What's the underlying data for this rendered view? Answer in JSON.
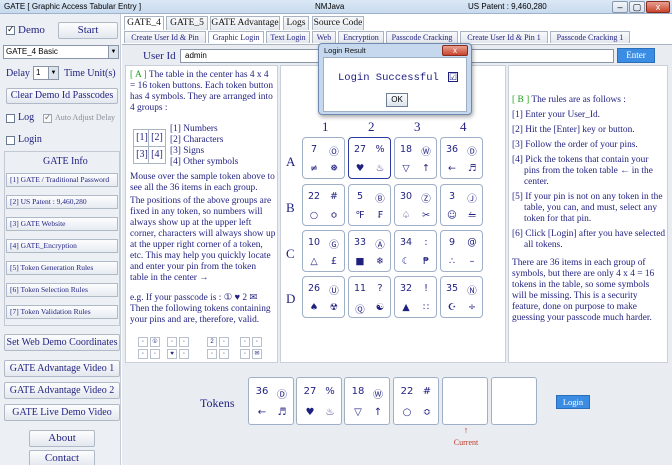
{
  "window": {
    "title": "GATE [ Graphic Access Tabular Entry ]",
    "center_title": "NMJava",
    "patent": "US Patent : 9,460,280",
    "min": "–",
    "max": "▢",
    "close": "x"
  },
  "sidebar": {
    "demo_label": "Demo",
    "start_label": "Start",
    "dropdown_value": "GATE_4 Basic",
    "delay_label": "Delay",
    "delay_value": "1",
    "time_unit_label": "Time Unit(s)",
    "clear_label": "Clear Demo Id Passcodes",
    "log_label": "Log",
    "auto_adjust_label": "Auto Adjust Delay",
    "login_label": "Login",
    "gate_info_label": "GATE Info",
    "info_items": [
      "[1] GATE / Traditional Password",
      "[2] US Patent : 9,460,280",
      "[3] GATE Website",
      "[4] GATE_Encryption",
      "[5] Token Generation Rules",
      "[6] Token Selection Rules",
      "[7] Token Validation Rules"
    ],
    "set_web_label": "Set Web Demo Coordinates",
    "video1_label": "GATE Advantage Video 1",
    "video2_label": "GATE Advantage Video 2",
    "live_label": "GATE Live Demo Video",
    "about_label": "About",
    "contact_label": "Contact"
  },
  "tabs": [
    "GATE_4",
    "GATE_5",
    "GATE Advantage",
    "Logs",
    "Source Code"
  ],
  "subtabs": [
    "Create User Id & Pin",
    "Graphic Login",
    "Text Login",
    "Web",
    "Encryption",
    "Passcode Cracking",
    "Create User Id & Pin 1",
    "Passcode Cracking 1"
  ],
  "user_id": {
    "label": "User Id",
    "value": "admin",
    "enter_label": "Enter"
  },
  "left_text": {
    "a_label": "[ A ]",
    "p1": "The table in the center has 4 x 4 = 16 token buttons. Each token button has 4 symbols. They are arranged into 4 groups :",
    "groups": [
      "[1] Numbers",
      "[2] Characters",
      "[3] Signs",
      "[4] Other symbols"
    ],
    "sample_keys": [
      "[1]",
      "[2]",
      "[3]",
      "[4]"
    ],
    "p2": "Mouse over the sample token above to see all the 36 items in each group.",
    "p3": "The positions of the above groups are fixed in any token, so numbers will always show up at the upper left corner, characters will always show up at the upper right corner of a token, etc. This may help you quickly locate and enter your pin from the token table in the center →",
    "p4": "e.g. If your passcode is : ① ♥ 2 ✉ Then the following tokens containing your pins and are, therefore, valid.",
    "example_tokens": [
      [
        "◦",
        "①",
        "◦",
        "◦"
      ],
      [
        "◦",
        "◦",
        "♥",
        "◦"
      ],
      [
        "2",
        "◦",
        "◦",
        "◦"
      ],
      [
        "◦",
        "◦",
        "◦",
        "✉"
      ]
    ]
  },
  "grid": {
    "col_labels": [
      "1",
      "2",
      "3",
      "4"
    ],
    "row_labels": [
      "A",
      "B",
      "C",
      "D"
    ],
    "rows": [
      [
        [
          "7",
          "Ⓞ",
          "≠",
          "❅"
        ],
        [
          "27",
          "%",
          "♥",
          "♨"
        ],
        [
          "18",
          "Ⓦ",
          "▽",
          "↑"
        ],
        [
          "36",
          "Ⓓ",
          "←",
          "♬"
        ]
      ],
      [
        [
          "22",
          "#",
          "○",
          "≎"
        ],
        [
          "5",
          "Ⓑ",
          "℉",
          "₣"
        ],
        [
          "30",
          "Ⓩ",
          "♤",
          "✂"
        ],
        [
          "3",
          "Ⓙ",
          "☺",
          "⥪"
        ]
      ],
      [
        [
          "10",
          "Ⓖ",
          "△",
          "£"
        ],
        [
          "33",
          "Ⓐ",
          "■",
          "❄"
        ],
        [
          "34",
          ":",
          "☾",
          "₱"
        ],
        [
          "9",
          "@",
          "∴",
          "–"
        ]
      ],
      [
        [
          "26",
          "Ⓤ",
          "♠",
          "☢"
        ],
        [
          "11",
          "?",
          "Ⓠ",
          "☯"
        ],
        [
          "32",
          "!",
          "▲",
          "∷"
        ],
        [
          "35",
          "Ⓝ",
          "☪",
          "÷"
        ]
      ]
    ]
  },
  "right_text": {
    "b_label": "[ B ]",
    "intro": "The rules are as follows :",
    "rules": [
      "[1] Enter your User_Id.",
      "[2] Hit the [Enter] key or button.",
      "[3] Follow the order of your pins.",
      "[4] Pick the tokens that contain your pins from the token table ← in the center.",
      "[5] If your pin is not on any token in the table, you can, and must, select any token for that pin.",
      "[6] Click [Login] after you have selected all tokens."
    ],
    "footer": "There are 36 items in each group of symbols, but there are only 4 x 4 = 16 tokens in the table, so some symbols will be missing. This is a security feature, done on purpose to make guessing your passcode much harder."
  },
  "tokens_bar": {
    "label": "Tokens",
    "selected": [
      [
        "36",
        "Ⓓ",
        "←",
        "♬"
      ],
      [
        "27",
        "%",
        "♥",
        "♨"
      ],
      [
        "18",
        "Ⓦ",
        "▽",
        "↑"
      ],
      [
        "22",
        "#",
        "○",
        "≎"
      ]
    ],
    "login_label": "Login",
    "current_label": "Current",
    "current_arrow": "↑"
  },
  "dialog": {
    "title": "Login Result",
    "message": "Login Successful",
    "ok_label": "OK",
    "close_label": "x",
    "check_icon": "☑"
  }
}
